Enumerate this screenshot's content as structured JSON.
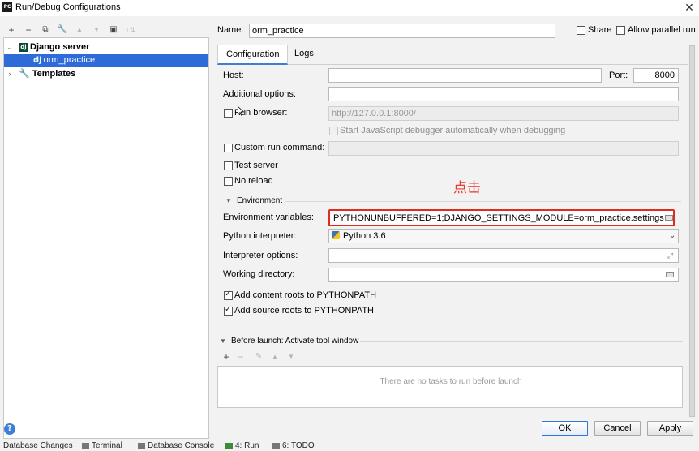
{
  "window": {
    "title": "Run/Debug Configurations",
    "close_glyph": "✕"
  },
  "left_toolbar": {
    "add": "+",
    "remove": "−",
    "copy": "⧉",
    "edit": "🔧",
    "move_up": "▲",
    "move_down": "▼",
    "folder": "▣",
    "sort": "↓⇅"
  },
  "tree": {
    "group_label": "Django server",
    "group_arrow": "⌄",
    "child_label": "orm_practice",
    "templates_label": "Templates",
    "templates_arrow": "›",
    "dj_badge": "dj",
    "group_badge": "dj"
  },
  "header": {
    "name_label": "Name:",
    "name_value": "orm_practice",
    "share_label": "Share",
    "parallel_label": "Allow parallel run"
  },
  "tabs": [
    {
      "label": "Configuration"
    },
    {
      "label": "Logs"
    }
  ],
  "config": {
    "host_label": "Host:",
    "host_value": "",
    "port_label": "Port:",
    "port_value": "8000",
    "additional_label": "Additional options:",
    "additional_value": "",
    "run_browser_label": "Run browser:",
    "run_browser_url": "http://127.0.0.1:8000/",
    "js_debugger_label": "Start JavaScript debugger automatically when debugging",
    "custom_cmd_label": "Custom run command:",
    "custom_cmd_value": "",
    "test_server_label": "Test server",
    "no_reload_label": "No reload",
    "environment_section": "Environment",
    "env_vars_label": "Environment variables:",
    "env_vars_value": "PYTHONUNBUFFERED=1;DJANGO_SETTINGS_MODULE=orm_practice.settings",
    "interpreter_label": "Python interpreter:",
    "interpreter_value": "Python 3.6",
    "interp_options_label": "Interpreter options:",
    "interp_options_value": "",
    "workdir_label": "Working directory:",
    "workdir_value": "",
    "content_roots_label": "Add content roots to PYTHONPATH",
    "source_roots_label": "Add source roots to PYTHONPATH",
    "content_roots_checked": true,
    "source_roots_checked": true
  },
  "annotation": {
    "text": "点击",
    "color": "#e63a2b"
  },
  "before_launch": {
    "section": "Before launch: Activate tool window",
    "add": "+",
    "remove": "−",
    "edit": "✎",
    "up": "▲",
    "down": "▼",
    "empty_text": "There are no tasks to run before launch"
  },
  "buttons": {
    "ok": "OK",
    "cancel": "Cancel",
    "apply": "Apply",
    "help": "?"
  },
  "statusbar": [
    {
      "label": "Database Changes"
    },
    {
      "label": "Terminal"
    },
    {
      "label": "Database Console"
    },
    {
      "label": "4: Run"
    },
    {
      "label": "6: TODO"
    }
  ],
  "colors": {
    "selection": "#2f6bd8",
    "highlight_border": "#e02b1e",
    "accent": "#3c7fd6"
  }
}
